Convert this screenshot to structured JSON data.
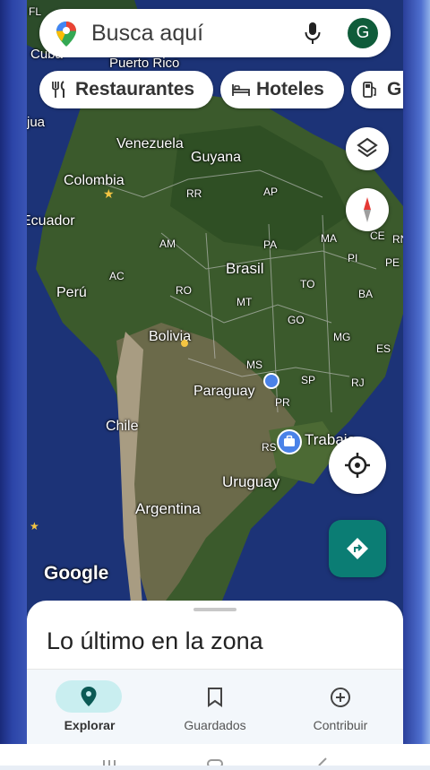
{
  "search": {
    "placeholder": "Busca aquí",
    "avatar_letter": "G"
  },
  "chips": [
    {
      "label": "Restaurantes",
      "icon": "fork-knife-icon"
    },
    {
      "label": "Hoteles",
      "icon": "bed-icon"
    },
    {
      "label": "G",
      "icon": "gas-pump-icon"
    }
  ],
  "map_labels": {
    "cuba": "Cuba",
    "fl": "FL",
    "puerto_rico": "Puerto Rico",
    "jua": "jua",
    "venezuela": "Venezuela",
    "guyana": "Guyana",
    "colombia": "Colombia",
    "rr": "RR",
    "ap": "AP",
    "ecuador": "Ecuador",
    "am": "AM",
    "pa": "PA",
    "ma": "MA",
    "ce": "CE",
    "rn": "RN",
    "pi": "PI",
    "pe": "PE",
    "brasil": "Brasil",
    "ac": "AC",
    "to": "TO",
    "peru": "Perú",
    "ro": "RO",
    "ba": "BA",
    "mt": "MT",
    "go": "GO",
    "mg": "MG",
    "bolivia": "Bolivia",
    "es": "ES",
    "ms": "MS",
    "sp": "SP",
    "paraguay": "Paraguay",
    "rj": "RJ",
    "pr": "PR",
    "chile": "Chile",
    "trabajo": "Trabajo",
    "rs": "RS",
    "uruguay": "Uruguay",
    "argentina": "Argentina"
  },
  "branding": {
    "google": "Google"
  },
  "sheet": {
    "title": "Lo último en la zona"
  },
  "nav": [
    {
      "label": "Explorar",
      "icon": "explore-pin-icon",
      "active": true
    },
    {
      "label": "Guardados",
      "icon": "bookmark-icon",
      "active": false
    },
    {
      "label": "Contribuir",
      "icon": "add-circle-icon",
      "active": false
    }
  ],
  "colors": {
    "accent": "#0b7d74",
    "active_pill": "#c9eef0",
    "avatar": "#0f5c3a"
  }
}
